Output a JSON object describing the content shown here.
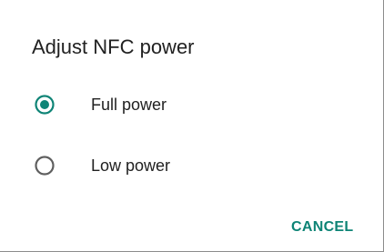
{
  "dialog": {
    "title": "Adjust NFC power",
    "options": [
      {
        "label": "Full power",
        "selected": true
      },
      {
        "label": "Low power",
        "selected": false
      }
    ],
    "cancel_label": "CANCEL"
  },
  "colors": {
    "accent": "#0e8476",
    "unselected_radio": "#5f5f5f",
    "text": "#212121"
  }
}
